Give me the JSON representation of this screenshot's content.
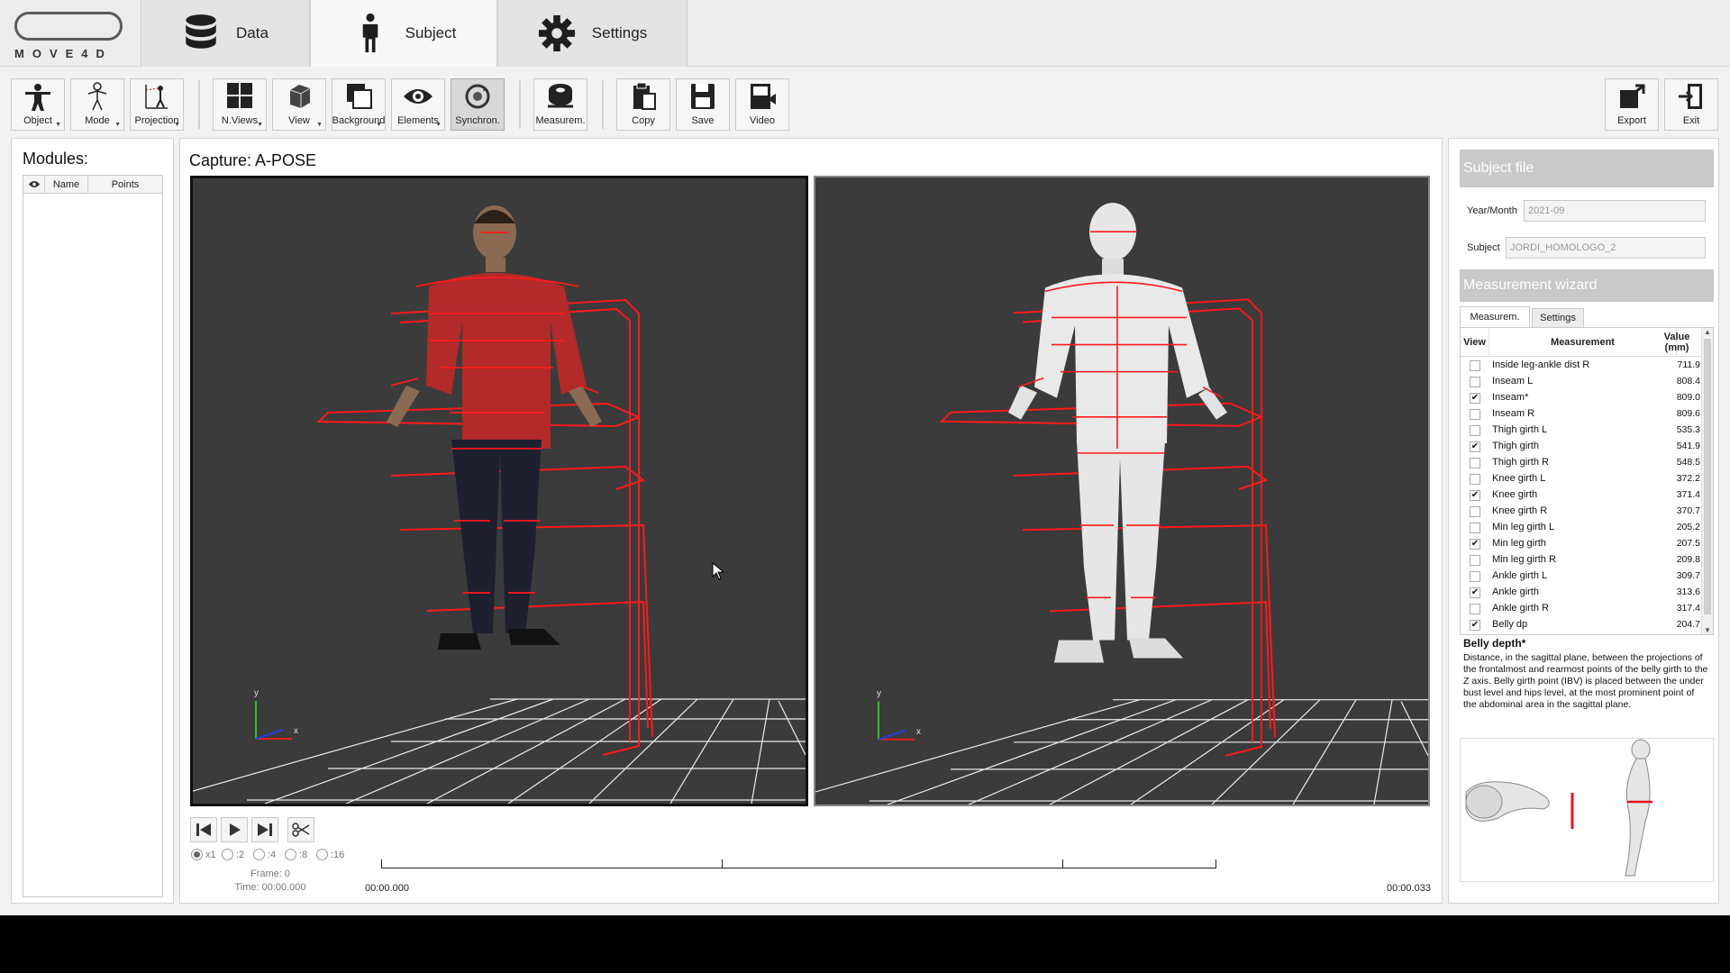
{
  "app": {
    "logo_text": "MOVE4D"
  },
  "tabs": [
    {
      "label": "Data",
      "icon": "database-icon"
    },
    {
      "label": "Subject",
      "icon": "person-icon"
    },
    {
      "label": "Settings",
      "icon": "gear-icon"
    }
  ],
  "toolbar": {
    "object": "Object",
    "mode": "Mode",
    "projection": "Projection",
    "nviews": "N.Views",
    "view": "View",
    "background": "Background",
    "elements": "Elements",
    "synchron": "Synchron.",
    "measurem": "Measurem.",
    "copy": "Copy",
    "save": "Save",
    "video": "Video",
    "export": "Export",
    "exit": "Exit"
  },
  "modules": {
    "title": "Modules:",
    "columns": [
      "Name",
      "Points"
    ]
  },
  "capture": {
    "title": "Capture: A-POSE"
  },
  "axes": {
    "y": "y",
    "x": "x",
    "z": "z"
  },
  "player": {
    "speeds": [
      "x1",
      ":2",
      ":4",
      ":8",
      ":16"
    ],
    "selected_speed": "x1",
    "frame": "Frame: 0",
    "time": "Time: 00:00.000",
    "start_time": "00:00.000",
    "end_time": "00:00.033"
  },
  "subject_file": {
    "title": "Subject file",
    "year_label": "Year/Month",
    "year_value": "2021-09",
    "subject_label": "Subject",
    "subject_value": "JORDI_HOMOLOGO_2"
  },
  "wizard": {
    "title": "Measurement wizard",
    "tabs": [
      "Measurem.",
      "Settings"
    ],
    "columns": {
      "view": "View",
      "measurement": "Measurement",
      "value": "Value (mm)"
    },
    "rows": [
      {
        "name": "Inside leg-ankle dist R",
        "value": "711.9",
        "checked": false
      },
      {
        "name": "Inseam L",
        "value": "808.4",
        "checked": false
      },
      {
        "name": "Inseam*",
        "value": "809.0",
        "checked": true
      },
      {
        "name": "Inseam R",
        "value": "809.6",
        "checked": false
      },
      {
        "name": "Thigh girth L",
        "value": "535.3",
        "checked": false
      },
      {
        "name": "Thigh girth",
        "value": "541.9",
        "checked": true
      },
      {
        "name": "Thigh girth R",
        "value": "548.5",
        "checked": false
      },
      {
        "name": "Knee girth L",
        "value": "372.2",
        "checked": false
      },
      {
        "name": "Knee girth",
        "value": "371.4",
        "checked": true
      },
      {
        "name": "Knee girth R",
        "value": "370.7",
        "checked": false
      },
      {
        "name": "Min leg girth L",
        "value": "205.2",
        "checked": false
      },
      {
        "name": "Min leg girth",
        "value": "207.5",
        "checked": true
      },
      {
        "name": "Min leg girth R",
        "value": "209.8",
        "checked": false
      },
      {
        "name": "Ankle girth L",
        "value": "309.7",
        "checked": false
      },
      {
        "name": "Ankle girth",
        "value": "313.6",
        "checked": true
      },
      {
        "name": "Ankle girth R",
        "value": "317.4",
        "checked": false
      },
      {
        "name": "Belly dp",
        "value": "204.7",
        "checked": true
      }
    ],
    "description_title": "Belly depth*",
    "description": "Distance, in the sagittal plane, between the projections of the frontalmost and rearmost points of the belly girth to the Z axis. Belly girth point (IBV) is placed between the under bust level and hips level, at the most prominent point of the abdominal area in the sagittal plane."
  },
  "colors": {
    "accent_red": "#e0141c",
    "viewport_bg": "#3b3b3b",
    "section_head": "#c9c9c9"
  }
}
